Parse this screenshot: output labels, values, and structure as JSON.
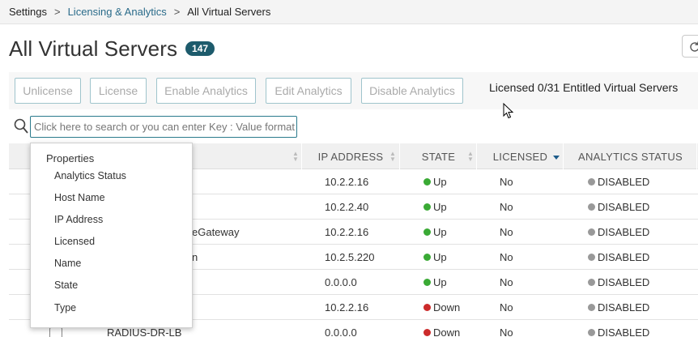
{
  "breadcrumb": {
    "items": [
      "Settings",
      "Licensing & Analytics",
      "All Virtual Servers"
    ],
    "separator": ">"
  },
  "page": {
    "title": "All Virtual Servers",
    "count": "147"
  },
  "toolbar": {
    "unlicense": "Unlicense",
    "license": "License",
    "enable_analytics": "Enable Analytics",
    "edit_analytics": "Edit Analytics",
    "disable_analytics": "Disable Analytics",
    "licensed_summary": "Licensed 0/31 Entitled Virtual Servers"
  },
  "search": {
    "placeholder": "Click here to search or you can enter Key : Value format"
  },
  "table": {
    "columns": [
      "IP ADDRESS",
      "STATE",
      "LICENSED",
      "ANALYTICS STATUS"
    ],
    "rows": [
      {
        "name": "",
        "ip": "10.2.2.16",
        "state": "Up",
        "licensed": "No",
        "analytics": "DISABLED"
      },
      {
        "name": "",
        "ip": "10.2.2.40",
        "state": "Up",
        "licensed": "No",
        "analytics": "DISABLED"
      },
      {
        "name": "eGateway",
        "ip": "10.2.2.16",
        "state": "Up",
        "licensed": "No",
        "analytics": "DISABLED"
      },
      {
        "name": "n",
        "ip": "10.2.5.220",
        "state": "Up",
        "licensed": "No",
        "analytics": "DISABLED"
      },
      {
        "name": "",
        "ip": "0.0.0.0",
        "state": "Up",
        "licensed": "No",
        "analytics": "DISABLED"
      },
      {
        "name": "",
        "ip": "10.2.2.16",
        "state": "Down",
        "licensed": "No",
        "analytics": "DISABLED"
      },
      {
        "name": "RADIUS-DR-LB",
        "ip": "0.0.0.0",
        "state": "Down",
        "licensed": "No",
        "analytics": "DISABLED"
      }
    ]
  },
  "properties_dropdown": {
    "header": "Properties",
    "items": [
      "Analytics Status",
      "Host Name",
      "IP Address",
      "Licensed",
      "Name",
      "State",
      "Type"
    ]
  },
  "colors": {
    "accent": "#1d5b6c",
    "link": "#2a6b8a",
    "up": "#3aaa35",
    "down": "#cc2b2b",
    "disabled": "#999999"
  }
}
